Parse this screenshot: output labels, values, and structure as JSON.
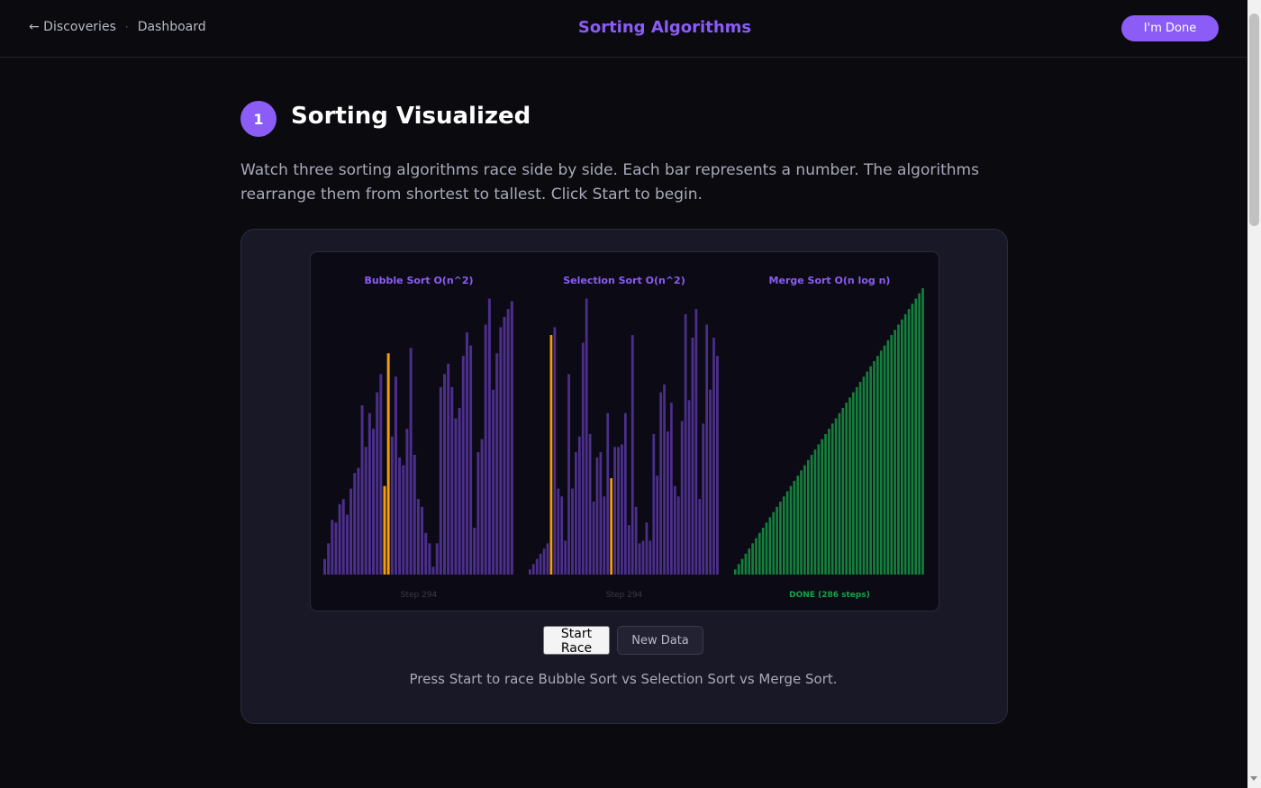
{
  "nav": {
    "back_label": "← Discoveries",
    "separator": "·",
    "dashboard_label": "Dashboard"
  },
  "app_title": "Sorting Algorithms",
  "done_button": "I'm Done",
  "section": {
    "number": "1",
    "title": "Sorting Visualized",
    "intro": "Watch three sorting algorithms race side by side. Each bar represents a number. The algorithms rearrange them from shortest to tallest. Click Start to begin."
  },
  "colors": {
    "accent": "#8b5cf6",
    "bar": "#4c2f8c",
    "highlight": "#f59e0b",
    "sorted": "#15803d",
    "done_text": "#16a34a",
    "step_text": "#3a3a48"
  },
  "chart_data": [
    {
      "type": "bar",
      "title": "Bubble Sort O(n^2)",
      "footer": "Step 294",
      "highlight_indices": [
        16,
        17
      ],
      "values": [
        6,
        12,
        21,
        20,
        27,
        29,
        23,
        33,
        39,
        41,
        65,
        49,
        62,
        56,
        70,
        77,
        34,
        85,
        53,
        76,
        45,
        42,
        56,
        87,
        46,
        29,
        26,
        16,
        12,
        3,
        12,
        72,
        77,
        81,
        72,
        60,
        64,
        84,
        93,
        88,
        18,
        47,
        52,
        96,
        106,
        71,
        85,
        95,
        99,
        102,
        105
      ],
      "ylim": [
        0,
        110
      ]
    },
    {
      "type": "bar",
      "title": "Selection Sort O(n^2)",
      "footer": "Step 294",
      "highlight_indices": [
        6,
        23
      ],
      "values": [
        2,
        4,
        6,
        8,
        10,
        12,
        92,
        95,
        33,
        30,
        13,
        77,
        33,
        47,
        53,
        89,
        106,
        54,
        28,
        45,
        47,
        30,
        62,
        37,
        49,
        49,
        50,
        62,
        19,
        92,
        26,
        12,
        13,
        20,
        13,
        54,
        38,
        70,
        73,
        55,
        66,
        34,
        30,
        59,
        100,
        67,
        91,
        102,
        29,
        58,
        96,
        71,
        91,
        84
      ],
      "ylim": [
        0,
        110
      ]
    },
    {
      "type": "bar",
      "title": "Merge Sort O(n log n)",
      "footer": "DONE (286 steps)",
      "sorted": true,
      "values": [
        2,
        4,
        6,
        8,
        10,
        12,
        14,
        16,
        18,
        20,
        22,
        24,
        26,
        28,
        30,
        32,
        34,
        36,
        38,
        40,
        42,
        44,
        46,
        48,
        50,
        52,
        54,
        56,
        58,
        60,
        62,
        64,
        66,
        68,
        70,
        72,
        74,
        76,
        78,
        80,
        82,
        84,
        86,
        88,
        90,
        92,
        94,
        96,
        98,
        100,
        102,
        104,
        106,
        108,
        110
      ],
      "ylim": [
        0,
        110
      ]
    }
  ],
  "controls": {
    "start_label": "Start Race",
    "new_data_label": "New Data"
  },
  "status_text": "Press Start to race Bubble Sort vs Selection Sort vs Merge Sort."
}
